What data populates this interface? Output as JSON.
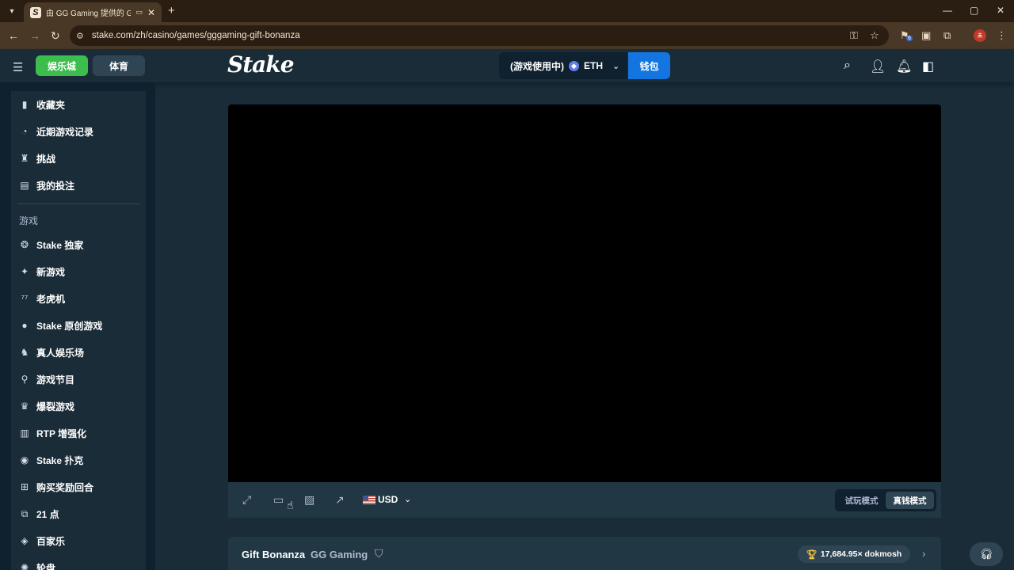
{
  "browser": {
    "tab_title": "由 GG Gaming 提供的 Gift Bonanza",
    "tab_favicon": "S",
    "tab_close": "✕",
    "new_tab": "+",
    "url": "stake.com/zh/casino/games/gggaming-gift-bonanza",
    "extension_badge": "6",
    "profile_initial": "未"
  },
  "header": {
    "casino_label": "娱乐城",
    "sports_label": "体育",
    "logo_text": "Stake",
    "currency_status": "(游戏使用中)",
    "currency_code": "ETH",
    "wallet_label": "钱包"
  },
  "sidebar": {
    "top_items": [
      {
        "label": "收藏夹",
        "icon": "bookmark-icon"
      },
      {
        "label": "近期游戏记录",
        "icon": "clock-icon"
      },
      {
        "label": "挑战",
        "icon": "trophy-icon"
      },
      {
        "label": "我的投注",
        "icon": "receipt-icon"
      }
    ],
    "games_heading": "游戏",
    "game_items": [
      {
        "label": "Stake 独家",
        "icon": "stake-icon"
      },
      {
        "label": "新游戏",
        "icon": "sparkle-icon"
      },
      {
        "label": "老虎机",
        "icon": "slots-icon"
      },
      {
        "label": "Stake 原创游戏",
        "icon": "flame-icon"
      },
      {
        "label": "真人娱乐场",
        "icon": "live-dealer-icon"
      },
      {
        "label": "游戏节目",
        "icon": "microphone-icon"
      },
      {
        "label": "爆裂游戏",
        "icon": "burst-icon"
      },
      {
        "label": "RTP 增强化",
        "icon": "rtp-icon"
      },
      {
        "label": "Stake 扑克",
        "icon": "poker-chip-icon"
      },
      {
        "label": "购买奖励回合",
        "icon": "gift-icon"
      },
      {
        "label": "21 点",
        "icon": "cards-icon"
      },
      {
        "label": "百家乐",
        "icon": "baccarat-icon"
      },
      {
        "label": "轮盘",
        "icon": "roulette-icon"
      }
    ]
  },
  "game_toolbar": {
    "currency": "USD",
    "mode_demo": "试玩模式",
    "mode_real": "真钱模式",
    "active_mode": "真钱模式"
  },
  "game_info": {
    "game_name": "Gift Bonanza",
    "provider": "GG Gaming",
    "record": "17,684.95× dokmosh"
  },
  "colors": {
    "accent_green": "#3dbd4e",
    "wallet_blue": "#1475e1",
    "sidebar_bg": "#0f212e",
    "main_bg": "#1a2c38"
  }
}
